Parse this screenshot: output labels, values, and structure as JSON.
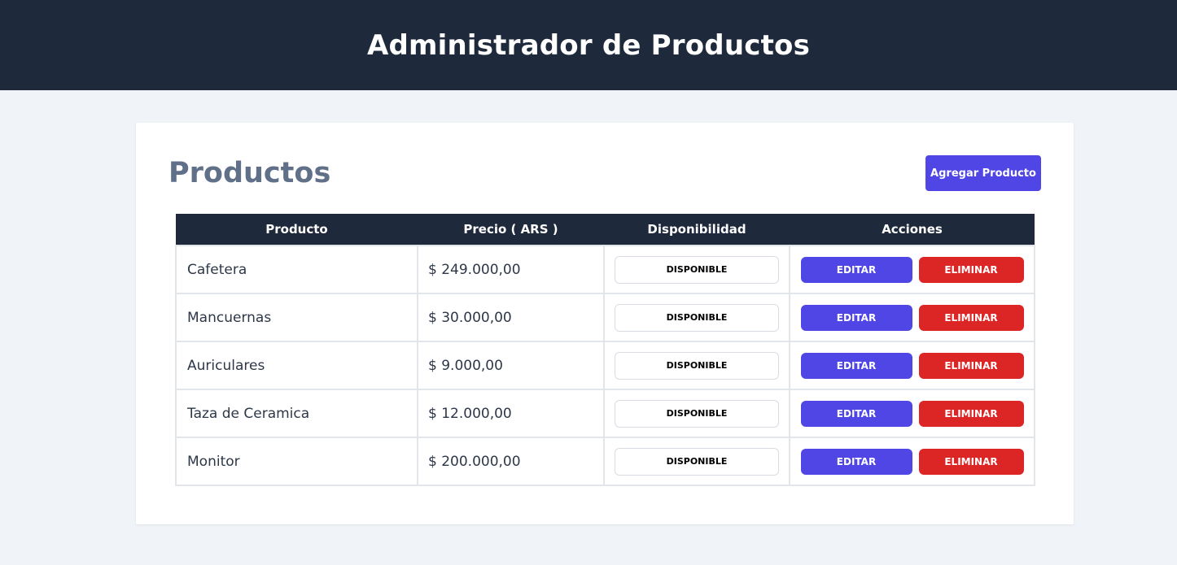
{
  "header": {
    "title": "Administrador de Productos"
  },
  "section": {
    "title": "Productos",
    "add_button_label": "Agregar Producto"
  },
  "table": {
    "columns": [
      "Producto",
      "Precio ( ARS )",
      "Disponibilidad",
      "Acciones"
    ],
    "rows": [
      {
        "name": "Cafetera",
        "price": "$ 249.000,00",
        "status": "DISPONIBLE"
      },
      {
        "name": "Mancuernas",
        "price": "$ 30.000,00",
        "status": "DISPONIBLE"
      },
      {
        "name": "Auriculares",
        "price": "$ 9.000,00",
        "status": "DISPONIBLE"
      },
      {
        "name": "Taza de Ceramica",
        "price": "$ 12.000,00",
        "status": "DISPONIBLE"
      },
      {
        "name": "Monitor",
        "price": "$ 200.000,00",
        "status": "DISPONIBLE"
      }
    ],
    "edit_label": "EDITAR",
    "delete_label": "ELIMINAR"
  },
  "colors": {
    "header_bg": "#1e293b",
    "page_bg": "#f0f4f8",
    "primary": "#4f46e5",
    "danger": "#dc2626",
    "title_text": "#5f7088"
  }
}
